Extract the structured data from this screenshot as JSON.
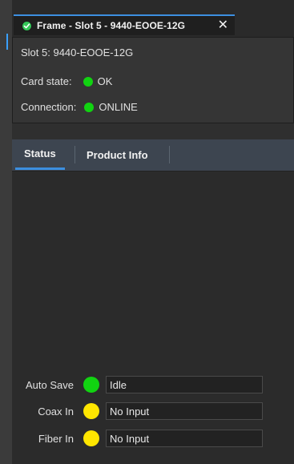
{
  "window": {
    "tab_title": "Frame - Slot 5 - 9440-EOOE-12G",
    "tab_icon": "check-circle-icon",
    "close_icon": "close-icon",
    "close_glyph": "✕"
  },
  "info": {
    "slot_line": "Slot 5: 9440-EOOE-12G",
    "card_state_label": "Card state:",
    "card_state_value": "OK",
    "card_state_color": "#11d311",
    "connection_label": "Connection:",
    "connection_value": "ONLINE",
    "connection_color": "#11d311"
  },
  "tabs": [
    {
      "label": "Status",
      "active": true
    },
    {
      "label": "Product Info",
      "active": false
    }
  ],
  "status_rows": [
    {
      "label": "Auto Save",
      "led_color": "#11d311",
      "value": "Idle"
    },
    {
      "label": "Coax In",
      "led_color": "#ffe600",
      "value": "No Input"
    },
    {
      "label": "Fiber In",
      "led_color": "#ffe600",
      "value": "No Input"
    }
  ],
  "colors": {
    "accent": "#3c8fe0",
    "ok_green": "#11d311",
    "warning_yellow": "#ffe600"
  }
}
